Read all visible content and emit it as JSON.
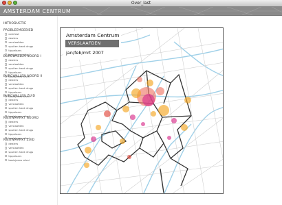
{
  "window": {
    "title": "Over_last"
  },
  "header": {
    "title": "AMSTERDAM CENTRUM"
  },
  "sidebar": {
    "intro": "INTRODUCTIE",
    "groups": [
      {
        "title": "PROBLEEMGEBIED",
        "items": [
          "overlast",
          "dealers",
          "verslaafden",
          "spuiten hard drugs",
          "tippelaars",
          "basisjeens afval"
        ]
      },
      {
        "title": "BURGWALLEN NOORD I",
        "items": [
          "dealers",
          "verslaafden",
          "spuiten hard drugs",
          "tippelaars",
          "basisjeens afval"
        ]
      },
      {
        "title": "BURGWALLEN NOORD II",
        "items": [
          "dealers",
          "verslaafden",
          "spuiten hard drugs",
          "tippelaars",
          "basisjeens afval"
        ]
      },
      {
        "title": "BURGWALLEN ZUID",
        "items": [
          "dealers",
          "verslaafden",
          "spuiten hard drugs",
          "tippelaars",
          "basisjeens afval"
        ]
      },
      {
        "title": "NIEUWMARKT NOORD",
        "items": [
          "dealers",
          "verslaafden",
          "spuiten hard drugs",
          "tippelaars",
          "basisjeens afval"
        ]
      },
      {
        "title": "NIEUWMARKT ZUID",
        "items": [
          "dealers",
          "verslaafden",
          "spuiten hard drugs",
          "tippelaars",
          "basisjeens afval"
        ]
      }
    ]
  },
  "map": {
    "title": "Amsterdam Centrum",
    "category": "VERSLAAFDEN",
    "period": "jan/feb/mrt 2007"
  },
  "colors": {
    "orange": "#f5a623",
    "salmon": "#ef7b6a",
    "red": "#e0483c",
    "magenta": "#d92f8c",
    "water": "#9fd0e8",
    "banner": "#8a8a8a",
    "tag": "#6f6f6f"
  }
}
